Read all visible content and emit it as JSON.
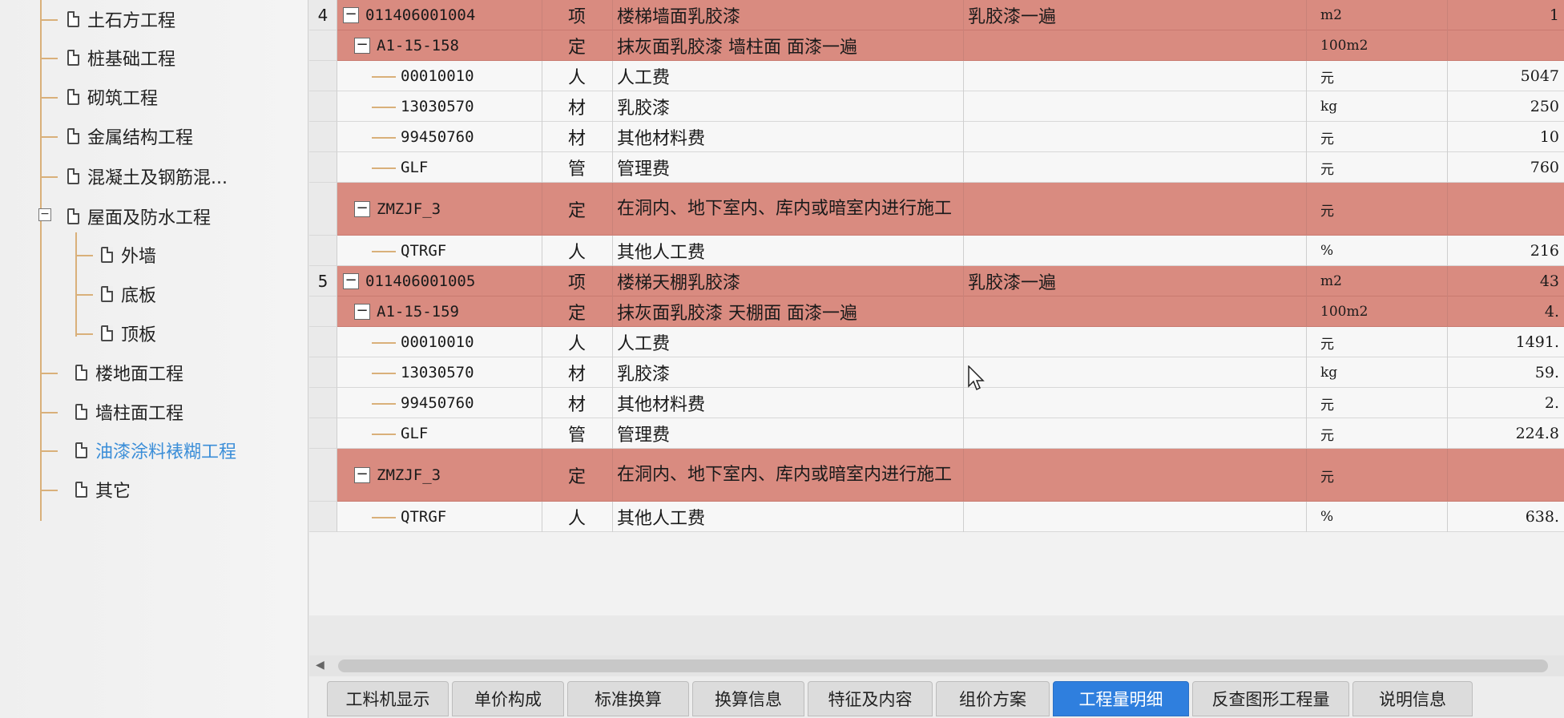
{
  "tree": {
    "items": [
      {
        "label": "土石方工程"
      },
      {
        "label": "桩基础工程"
      },
      {
        "label": "砌筑工程"
      },
      {
        "label": "金属结构工程"
      },
      {
        "label": "混凝土及钢筋混..."
      },
      {
        "label": "屋面及防水工程",
        "expanded": true
      },
      {
        "label": "外墙"
      },
      {
        "label": "底板"
      },
      {
        "label": "顶板"
      },
      {
        "label": "楼地面工程"
      },
      {
        "label": "墙柱面工程"
      },
      {
        "label": "油漆涂料裱糊工程",
        "selected": true
      },
      {
        "label": "其它"
      }
    ],
    "collapse_symbol": "−"
  },
  "grid": {
    "rows": [
      {
        "num": "4",
        "code": "011406001004",
        "type": "项",
        "name": "楼梯墙面乳胶漆",
        "feature": "乳胶漆一遍",
        "unit": "m2",
        "value": "1",
        "level": 0,
        "kind": "pink"
      },
      {
        "num": "",
        "code": "A1-15-158",
        "type": "定",
        "name": "抹灰面乳胶漆 墙柱面 面漆一遍",
        "feature": "",
        "unit": "100m2",
        "value": "",
        "level": 1,
        "kind": "pink"
      },
      {
        "num": "",
        "code": "00010010",
        "type": "人",
        "name": "人工费",
        "feature": "",
        "unit": "元",
        "value": "5047",
        "level": 2,
        "kind": "plain"
      },
      {
        "num": "",
        "code": "13030570",
        "type": "材",
        "name": "乳胶漆",
        "feature": "",
        "unit": "kg",
        "value": "250",
        "level": 2,
        "kind": "plain"
      },
      {
        "num": "",
        "code": "99450760",
        "type": "材",
        "name": "其他材料费",
        "feature": "",
        "unit": "元",
        "value": "10",
        "level": 2,
        "kind": "plain"
      },
      {
        "num": "",
        "code": "GLF",
        "type": "管",
        "name": "管理费",
        "feature": "",
        "unit": "元",
        "value": "760",
        "level": 2,
        "kind": "plain"
      },
      {
        "num": "",
        "code": "ZMZJF_3",
        "type": "定",
        "name": "在洞内、地下室内、库内或暗室内进行施工",
        "feature": "",
        "unit": "元",
        "value": "",
        "level": 1,
        "kind": "pink",
        "tall": true
      },
      {
        "num": "",
        "code": "QTRGF",
        "type": "人",
        "name": "其他人工费",
        "feature": "",
        "unit": "%",
        "value": "216",
        "level": 2,
        "kind": "plain"
      },
      {
        "num": "5",
        "code": "011406001005",
        "type": "项",
        "name": "楼梯天棚乳胶漆",
        "feature": "乳胶漆一遍",
        "unit": "m2",
        "value": "43",
        "level": 0,
        "kind": "pink"
      },
      {
        "num": "",
        "code": "A1-15-159",
        "type": "定",
        "name": "抹灰面乳胶漆 天棚面 面漆一遍",
        "feature": "",
        "unit": "100m2",
        "value": "4.",
        "level": 1,
        "kind": "pink"
      },
      {
        "num": "",
        "code": "00010010",
        "type": "人",
        "name": "人工费",
        "feature": "",
        "unit": "元",
        "value": "1491.",
        "level": 2,
        "kind": "plain"
      },
      {
        "num": "",
        "code": "13030570",
        "type": "材",
        "name": "乳胶漆",
        "feature": "",
        "unit": "kg",
        "value": "59.",
        "level": 2,
        "kind": "plain"
      },
      {
        "num": "",
        "code": "99450760",
        "type": "材",
        "name": "其他材料费",
        "feature": "",
        "unit": "元",
        "value": "2.",
        "level": 2,
        "kind": "plain"
      },
      {
        "num": "",
        "code": "GLF",
        "type": "管",
        "name": "管理费",
        "feature": "",
        "unit": "元",
        "value": "224.8",
        "level": 2,
        "kind": "plain"
      },
      {
        "num": "",
        "code": "ZMZJF_3",
        "type": "定",
        "name": "在洞内、地下室内、库内或暗室内进行施工",
        "feature": "",
        "unit": "元",
        "value": "",
        "level": 1,
        "kind": "pink",
        "tall": true
      },
      {
        "num": "",
        "code": "QTRGF",
        "type": "人",
        "name": "其他人工费",
        "feature": "",
        "unit": "%",
        "value": "638.",
        "level": 2,
        "kind": "plain"
      }
    ]
  },
  "scroll": {
    "left_arrow": "◀"
  },
  "tabs": [
    {
      "label": "工料机显示"
    },
    {
      "label": "单价构成"
    },
    {
      "label": "标准换算"
    },
    {
      "label": "换算信息"
    },
    {
      "label": "特征及内容"
    },
    {
      "label": "组价方案"
    },
    {
      "label": "工程量明细",
      "active": true
    },
    {
      "label": "反查图形工程量"
    },
    {
      "label": "说明信息"
    }
  ],
  "colors": {
    "row_highlight": "#d98b80",
    "tab_active": "#2f7fde",
    "tree_selected_text": "#3b8ed8"
  }
}
